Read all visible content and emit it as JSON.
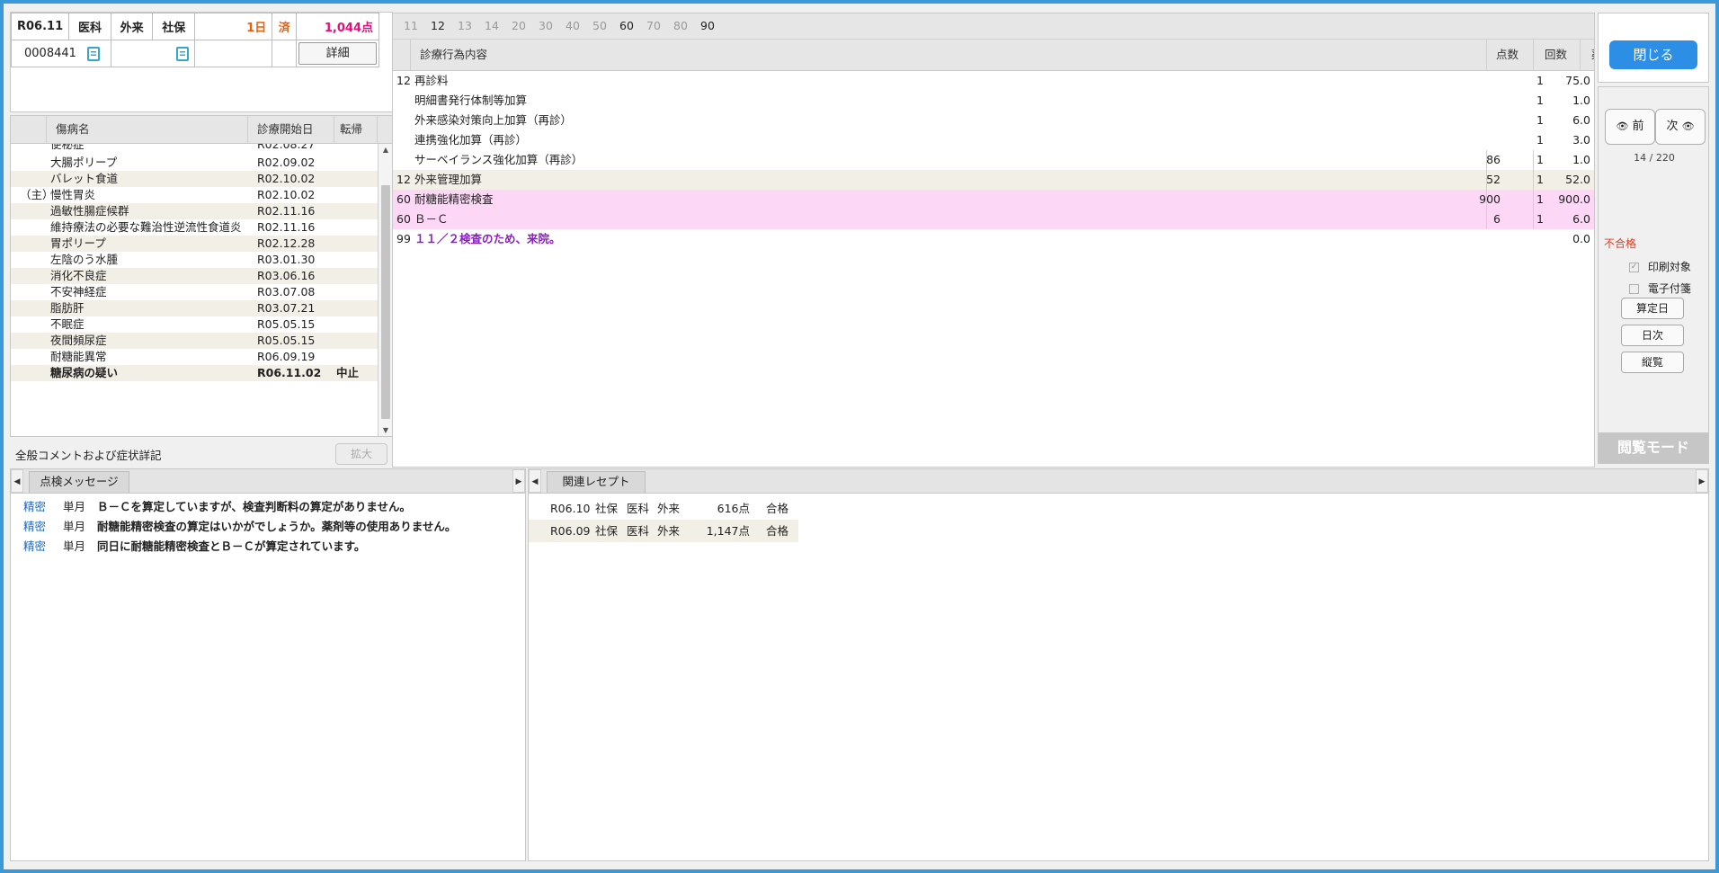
{
  "header": {
    "month": "R06.11",
    "dept": "医科",
    "visit_type": "外来",
    "insurance": "社保",
    "days": "1日",
    "done": "済",
    "points": "1,044点",
    "patient_id": "0008441",
    "detail_label": "詳細"
  },
  "disease_table": {
    "columns": [
      "傷病名",
      "診療開始日",
      "転帰"
    ],
    "partial_top": {
      "name": "便秘症",
      "date": "R02.08.27"
    },
    "rows": [
      {
        "mark": "",
        "name": "大腸ポリープ",
        "date": "R02.09.02",
        "outcome": ""
      },
      {
        "mark": "",
        "name": "バレット食道",
        "date": "R02.10.02",
        "outcome": ""
      },
      {
        "mark": "（主）",
        "name": "慢性胃炎",
        "date": "R02.10.02",
        "outcome": ""
      },
      {
        "mark": "",
        "name": "過敏性腸症候群",
        "date": "R02.11.16",
        "outcome": ""
      },
      {
        "mark": "",
        "name": "維持療法の必要な難治性逆流性食道炎",
        "date": "R02.11.16",
        "outcome": ""
      },
      {
        "mark": "",
        "name": "胃ポリープ",
        "date": "R02.12.28",
        "outcome": ""
      },
      {
        "mark": "",
        "name": "左陰のう水腫",
        "date": "R03.01.30",
        "outcome": ""
      },
      {
        "mark": "",
        "name": "消化不良症",
        "date": "R03.06.16",
        "outcome": ""
      },
      {
        "mark": "",
        "name": "不安神経症",
        "date": "R03.07.08",
        "outcome": ""
      },
      {
        "mark": "",
        "name": "脂肪肝",
        "date": "R03.07.21",
        "outcome": ""
      },
      {
        "mark": "",
        "name": "不眠症",
        "date": "R05.05.15",
        "outcome": ""
      },
      {
        "mark": "",
        "name": "夜間頻尿症",
        "date": "R05.05.15",
        "outcome": ""
      },
      {
        "mark": "",
        "name": "耐糖能異常",
        "date": "R06.09.19",
        "outcome": ""
      },
      {
        "mark": "",
        "name": "糖尿病の疑い",
        "date": "R06.11.02",
        "outcome": "中止",
        "bold": true
      }
    ]
  },
  "comment": {
    "label": "全般コメントおよび症状詳記",
    "expand_label": "拡大"
  },
  "category_tabs": [
    {
      "label": "11",
      "active": false
    },
    {
      "label": "12",
      "active": true
    },
    {
      "label": "13",
      "active": false
    },
    {
      "label": "14",
      "active": false
    },
    {
      "label": "20",
      "active": false
    },
    {
      "label": "30",
      "active": false
    },
    {
      "label": "40",
      "active": false
    },
    {
      "label": "50",
      "active": false
    },
    {
      "label": "60",
      "active": true
    },
    {
      "label": "70",
      "active": false
    },
    {
      "label": "80",
      "active": false
    },
    {
      "label": "90",
      "active": true
    }
  ],
  "treatment_table": {
    "columns": [
      "診療行為内容",
      "点数",
      "回数",
      "薬価"
    ],
    "rows": [
      {
        "code": "12",
        "content": "再診料",
        "points": "",
        "count": "1",
        "price": "75.0",
        "style": ""
      },
      {
        "code": "",
        "content": "明細書発行体制等加算",
        "points": "",
        "count": "1",
        "price": "1.0",
        "style": ""
      },
      {
        "code": "",
        "content": "外来感染対策向上加算（再診）",
        "points": "",
        "count": "1",
        "price": "6.0",
        "style": ""
      },
      {
        "code": "",
        "content": "連携強化加算（再診）",
        "points": "",
        "count": "1",
        "price": "3.0",
        "style": ""
      },
      {
        "code": "",
        "content": "サーベイランス強化加算（再診）",
        "points": "86",
        "count": "1",
        "price": "1.0",
        "style": ""
      },
      {
        "code": "12",
        "content": "外来管理加算",
        "points": "52",
        "count": "1",
        "price": "52.0",
        "style": "alt"
      },
      {
        "code": "60",
        "content": "耐糖能精密検査",
        "points": "900",
        "count": "1",
        "price": "900.0",
        "style": "hl"
      },
      {
        "code": "60",
        "content": "Ｂ－Ｃ",
        "points": "6",
        "count": "1",
        "price": "6.0",
        "style": "hl"
      },
      {
        "code": "99",
        "content": "１１／２検査のため、来院。",
        "points": "",
        "count": "",
        "price": "0.0",
        "style": "comment"
      }
    ]
  },
  "side": {
    "close_label": "閉じる",
    "prev_label": "前",
    "next_label": "次",
    "page_counter": "14 / 220",
    "status": "不合格",
    "print_target_label": "印刷対象",
    "e_tag_label": "電子付箋",
    "calc_date_label": "算定日",
    "daily_label": "日次",
    "overview_label": "縦覧",
    "mode_label": "閲覧モード"
  },
  "check_messages": {
    "tab_label": "点検メッセージ",
    "rows": [
      {
        "type": "精密",
        "period": "単月",
        "text": "Ｂ－Ｃを算定していますが、検査判断料の算定がありません。"
      },
      {
        "type": "精密",
        "period": "単月",
        "text": "耐糖能精密検査の算定はいかがでしょうか。薬剤等の使用ありません。"
      },
      {
        "type": "精密",
        "period": "単月",
        "text": "同日に耐糖能精密検査とＢ－Ｃが算定されています。"
      }
    ]
  },
  "related_receipts": {
    "tab_label": "関連レセプト",
    "rows": [
      {
        "month": "R06.10",
        "insurance": "社保",
        "dept": "医科",
        "visit": "外来",
        "points": "616点",
        "result": "合格"
      },
      {
        "month": "R06.09",
        "insurance": "社保",
        "dept": "医科",
        "visit": "外来",
        "points": "1,147点",
        "result": "合格"
      }
    ]
  },
  "colors": {
    "accent": "#2d8ee6",
    "frame": "#3a9ad9",
    "highlight_row": "#fcd8f6",
    "alt_row": "#f2f0e6",
    "status_red": "#e23b1d",
    "comment_purple": "#8b1fc4",
    "message_type_blue": "#1f66b5"
  },
  "icons": {
    "memo_icon": "document-lines-icon",
    "prev_icon": "eye-icon",
    "next_icon": "eye-icon"
  }
}
